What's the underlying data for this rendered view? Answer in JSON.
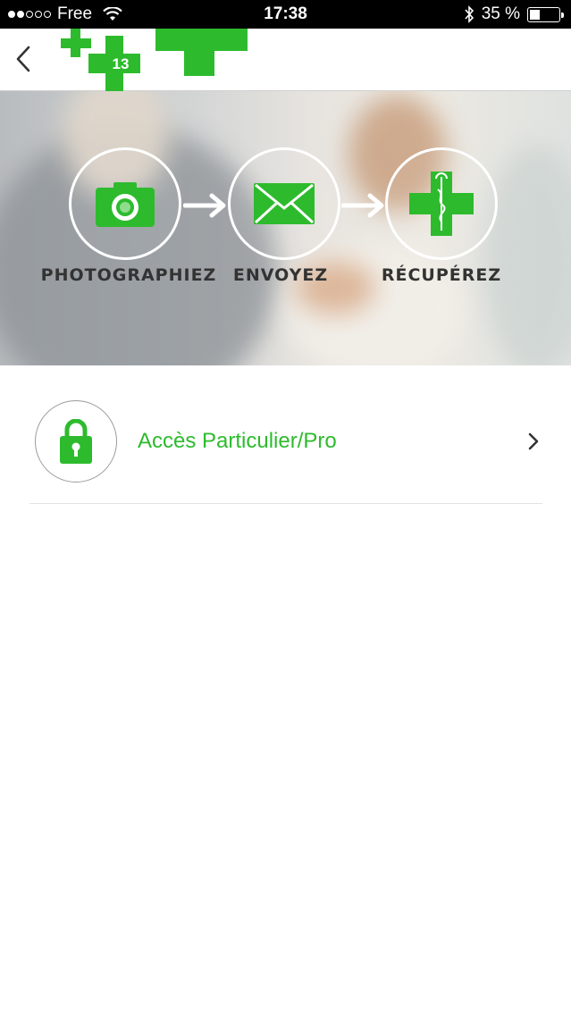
{
  "status_bar": {
    "carrier": "Free",
    "signal_filled": 2,
    "signal_total": 5,
    "time": "17:38",
    "battery_percent_text": "35 %",
    "battery_level": 0.35
  },
  "nav": {
    "back_icon": "chevron-left-icon",
    "logo_number": "13"
  },
  "hero": {
    "steps": [
      {
        "icon": "camera-icon",
        "label": "PHOTOGRAPHIEZ"
      },
      {
        "icon": "envelope-icon",
        "label": "ENVOYEZ"
      },
      {
        "icon": "pharmacy-cross-icon",
        "label": "RÉCUPÉREZ"
      }
    ]
  },
  "access": {
    "icon": "lock-icon",
    "label": "Accès Particulier/Pro",
    "chevron_icon": "chevron-right-icon"
  },
  "colors": {
    "brand_green": "#2dbb2d",
    "status_bar_bg": "#000000"
  }
}
